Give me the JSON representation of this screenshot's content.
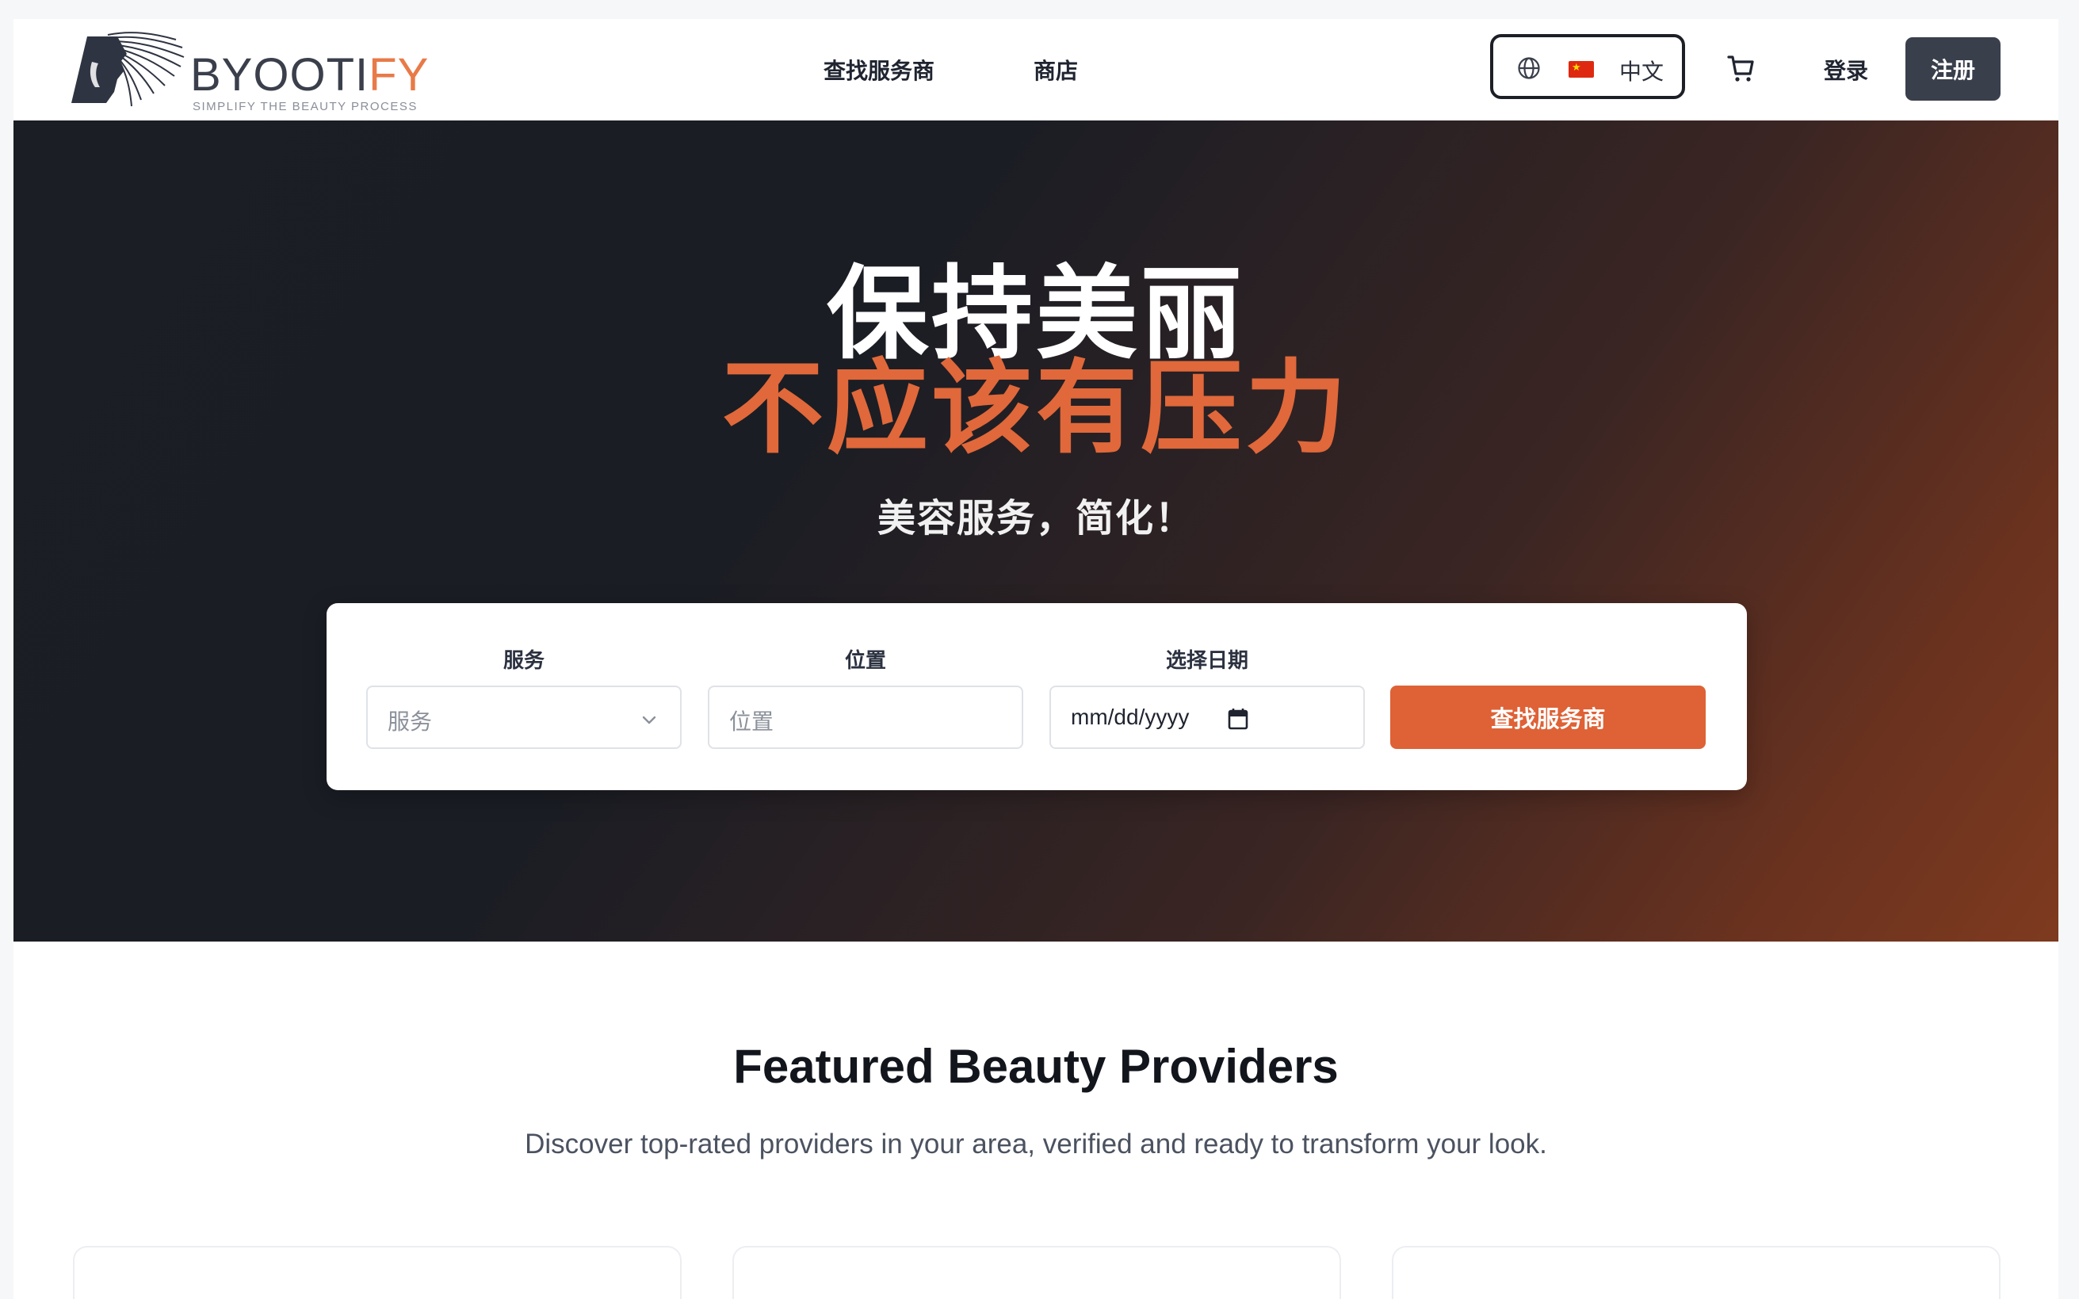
{
  "header": {
    "logo": {
      "word_main": "BYOOTI",
      "word_accent": "FY",
      "tagline": "SIMPLIFY THE BEAUTY PROCESS"
    },
    "nav": [
      {
        "label": "查找服务商"
      },
      {
        "label": "商店"
      }
    ],
    "language": {
      "icon": "globe-icon",
      "flag": "china-flag",
      "label": "中文"
    },
    "cart_icon": "cart-icon",
    "login_label": "登录",
    "signup_label": "注册"
  },
  "hero": {
    "title_line1": "保持美丽",
    "title_line2": "不应该有压力",
    "subtitle": "美容服务，简化！",
    "search": {
      "service": {
        "label": "服务",
        "placeholder": "服务"
      },
      "location": {
        "label": "位置",
        "placeholder": "位置"
      },
      "date": {
        "label": "选择日期",
        "value": "mm/dd/yyyy"
      },
      "button_label": "查找服务商"
    }
  },
  "featured": {
    "title": "Featured Beauty Providers",
    "subtitle": "Discover top-rated providers in your area, verified and ready to transform your look."
  },
  "colors": {
    "accent": "#de6236",
    "dark_button": "#3a3f4c",
    "hero_dark": "#1b1e25"
  }
}
